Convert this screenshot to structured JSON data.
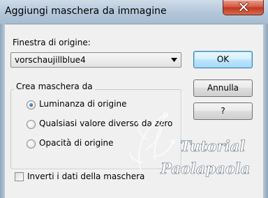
{
  "window": {
    "title": "Aggiungi maschera da immagine"
  },
  "source": {
    "label": "Finestra di origine:",
    "selected": "vorschaujillblue4"
  },
  "buttons": {
    "ok": "OK",
    "cancel": "Annulla",
    "help": "?"
  },
  "mask_group": {
    "legend": "Crea maschera da",
    "options": [
      {
        "label": "Luminanza di origine",
        "selected": true
      },
      {
        "label": "Qualsiasi valore diverso da zero",
        "selected": false
      },
      {
        "label": "Opacità di origine",
        "selected": false
      }
    ]
  },
  "invert": {
    "label": "Inverti i dati della maschera",
    "checked": false
  },
  "watermark": {
    "line1": "Tutorial",
    "line2": "Paolapaola"
  },
  "colors": {
    "title_bar": "#b3c6d9",
    "close_button": "#c2361e",
    "dialog_bg": "#f0f0f0",
    "default_button_border": "#3c7fb1",
    "radio_selected": "#1c5fa8"
  },
  "icons": {
    "close": "close-icon",
    "dropdown": "chevron-down-icon"
  }
}
